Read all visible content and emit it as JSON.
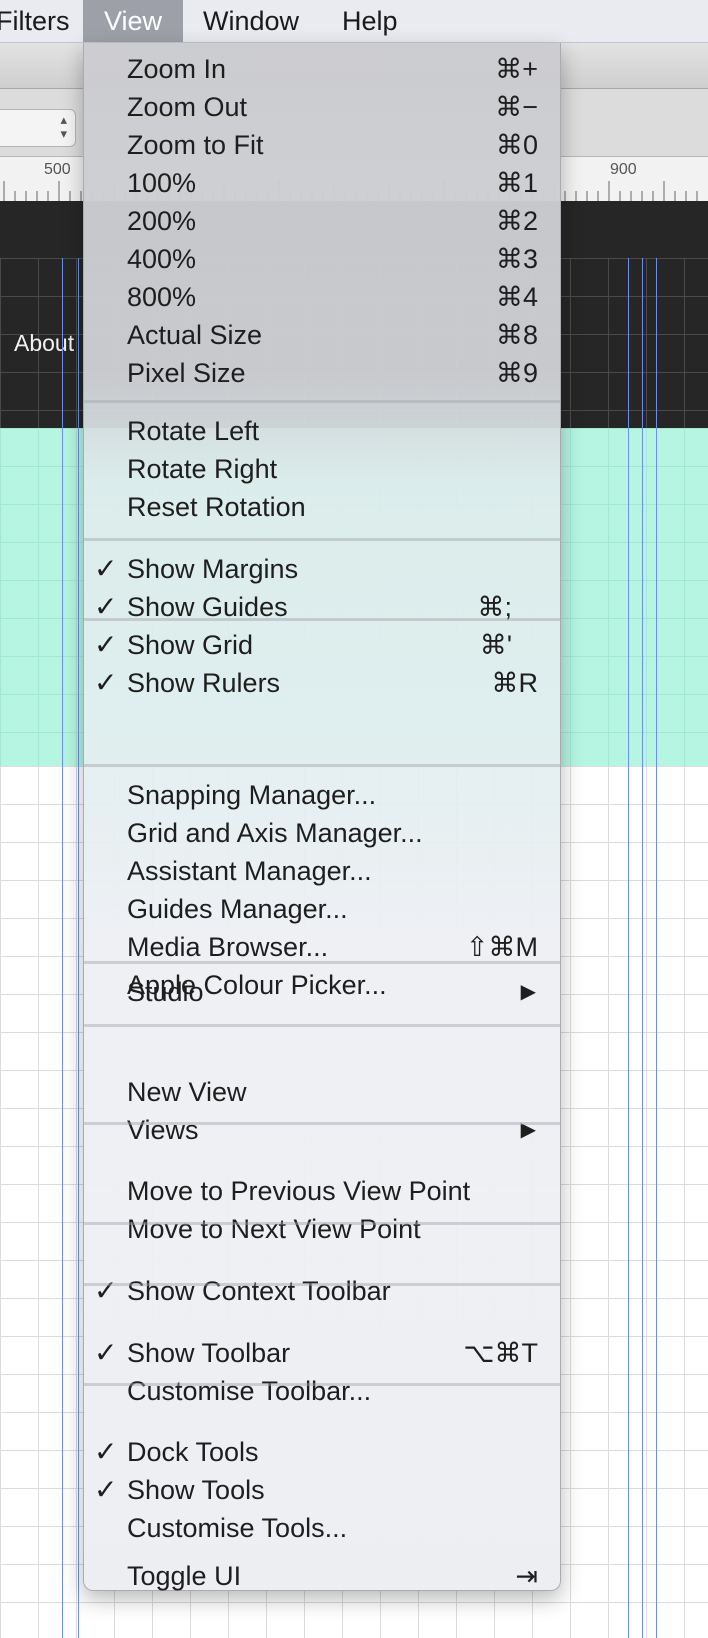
{
  "menubar": {
    "items": [
      "Filters",
      "View",
      "Window",
      "Help"
    ],
    "active": "View"
  },
  "canvas": {
    "ruler_labels": [
      "500",
      "900"
    ],
    "nav_label": "About",
    "stepper_arrows": "▴▾"
  },
  "menu": {
    "groups": [
      [
        {
          "label": "Zoom In",
          "shortcut": "⌘+"
        },
        {
          "label": "Zoom Out",
          "shortcut": "⌘−"
        },
        {
          "label": "Zoom to Fit",
          "shortcut": "⌘0"
        },
        {
          "label": "100%",
          "shortcut": "⌘1"
        },
        {
          "label": "200%",
          "shortcut": "⌘2"
        },
        {
          "label": "400%",
          "shortcut": "⌘3"
        },
        {
          "label": "800%",
          "shortcut": "⌘4"
        },
        {
          "label": "Actual Size",
          "shortcut": "⌘8"
        },
        {
          "label": "Pixel Size",
          "shortcut": "⌘9"
        }
      ],
      [
        {
          "label": "Rotate Left"
        },
        {
          "label": "Rotate Right"
        },
        {
          "label": "Reset Rotation"
        }
      ],
      [
        {
          "label": "Show Margins",
          "checked": true
        },
        {
          "label": "Show Guides",
          "checked": true,
          "shortcut": "⌘;"
        },
        {
          "label": "Show Grid",
          "checked": true,
          "shortcut": "⌘'"
        },
        {
          "label": "Show Rulers",
          "checked": true,
          "shortcut": "⌘R"
        }
      ],
      [
        {
          "label": "Snapping Manager..."
        },
        {
          "label": "Grid and Axis Manager..."
        },
        {
          "label": "Assistant Manager..."
        },
        {
          "label": "Guides Manager..."
        },
        {
          "label": "Media Browser...",
          "shortcut": "⇧⌘M"
        },
        {
          "label": "Apple Colour Picker..."
        }
      ],
      [
        {
          "label": "Studio",
          "submenu": true
        }
      ],
      [
        {
          "label": "New View"
        },
        {
          "label": "Views",
          "submenu": true
        }
      ],
      [
        {
          "label": "Move to Previous View Point"
        },
        {
          "label": "Move to Next View Point"
        }
      ],
      [
        {
          "label": "Show Context Toolbar",
          "checked": true
        }
      ],
      [
        {
          "label": "Show Toolbar",
          "checked": true,
          "shortcut": "⌥⌘T"
        },
        {
          "label": "Customise Toolbar..."
        }
      ],
      [
        {
          "label": "Dock Tools",
          "checked": true
        },
        {
          "label": "Show Tools",
          "checked": true
        },
        {
          "label": "Customise Tools..."
        }
      ],
      [
        {
          "label": "Toggle UI",
          "shortcut": "⇥"
        }
      ]
    ],
    "check_glyph": "✓",
    "submenu_glyph": "▶"
  },
  "colors": {
    "guide_blue": "#6f8fe6",
    "teal_band": "#b5f5e2",
    "dark_band": "#262626",
    "menu_active": "#9da0a8"
  }
}
